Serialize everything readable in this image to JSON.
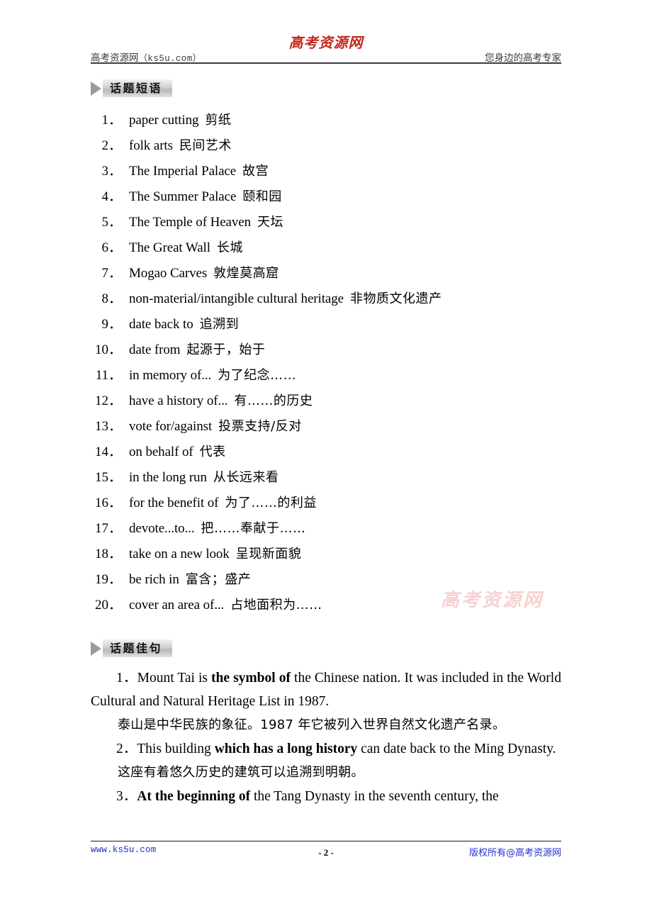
{
  "header": {
    "left_text": "高考资源网",
    "left_paren": "（ks5u.com）",
    "logo": "高考资源网",
    "right_text": "您身边的高考专家"
  },
  "sections": [
    {
      "title": "话题短语"
    },
    {
      "title": "话题佳句"
    }
  ],
  "phrases": [
    {
      "num": "1．",
      "en": "paper cutting",
      "cn": "剪纸"
    },
    {
      "num": "2．",
      "en": "folk arts",
      "cn": "民间艺术"
    },
    {
      "num": "3．",
      "en": "The Imperial Palace",
      "cn": "故宫"
    },
    {
      "num": "4．",
      "en": "The Summer Palace",
      "cn": "颐和园"
    },
    {
      "num": "5．",
      "en": "The Temple of Heaven",
      "cn": "天坛"
    },
    {
      "num": "6．",
      "en": "The Great Wall",
      "cn": "长城"
    },
    {
      "num": "7．",
      "en": "Mogao Carves",
      "cn": "敦煌莫高窟"
    },
    {
      "num": "8．",
      "en": "non-material/intangible cultural heritage",
      "cn": "非物质文化遗产"
    },
    {
      "num": "9．",
      "en": "date back to",
      "cn": "追溯到"
    },
    {
      "num": "10．",
      "en": "date from",
      "cn": "起源于，始于"
    },
    {
      "num": "11．",
      "en": "in memory of...",
      "cn": "为了纪念……"
    },
    {
      "num": "12．",
      "en": "have a history of...",
      "cn": "有……的历史"
    },
    {
      "num": "13．",
      "en": "vote for/against",
      "cn": "投票支持/反对"
    },
    {
      "num": "14．",
      "en": "on behalf of",
      "cn": "代表"
    },
    {
      "num": "15．",
      "en": "in the long run",
      "cn": "从长远来看"
    },
    {
      "num": "16．",
      "en": "for the benefit of",
      "cn": "为了……的利益"
    },
    {
      "num": "17．",
      "en": "devote...to...",
      "cn": "把……奉献于……"
    },
    {
      "num": "18．",
      "en": "take on a new look",
      "cn": "呈现新面貌"
    },
    {
      "num": "19．",
      "en": "be rich in",
      "cn": "富含；盛产"
    },
    {
      "num": "20．",
      "en": "cover an area of...",
      "cn": "占地面积为……"
    }
  ],
  "sentences": [
    {
      "num": "1．",
      "en_pre": "Mount Tai is ",
      "en_bold": "the symbol of",
      "en_post": " the Chinese nation. It was included in the World Cultural and Natural Heritage List in 1987.",
      "cn": "泰山是中华民族的象征。1987 年它被列入世界自然文化遗产名录。"
    },
    {
      "num": "2．",
      "en_pre": "This building ",
      "en_bold": "which has a long history",
      "en_post": " can date back to the Ming Dynasty.",
      "cn": "这座有着悠久历史的建筑可以追溯到明朝。"
    },
    {
      "num": "3．",
      "en_pre": "",
      "en_bold": "At the beginning of",
      "en_post": " the Tang Dynasty in the seventh century, the",
      "cn": ""
    }
  ],
  "watermark": {
    "text": "高考资源网"
  },
  "footer": {
    "left": "www.ks5u.com",
    "center": "- 2 -",
    "right": "版权所有@高考资源网"
  },
  "colors": {
    "logo_red": "#c0281e",
    "footer_blue": "#2230c8",
    "watermark_pink": "#f6c8c8"
  }
}
